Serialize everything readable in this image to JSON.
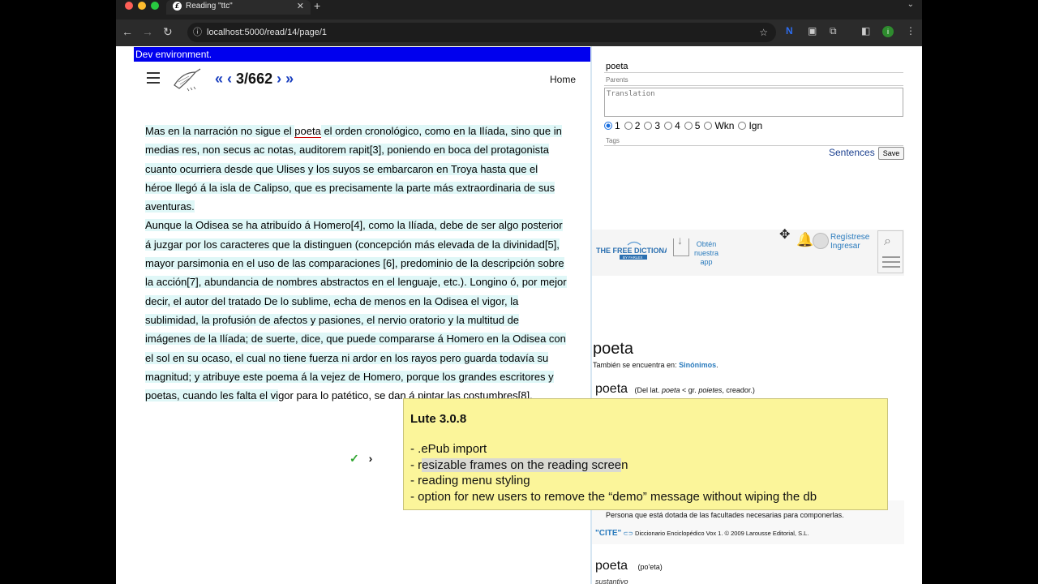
{
  "browser": {
    "tab_title": "Reading \"ttc\"",
    "tab_favicon_letter": "£",
    "url": "localhost:5000/read/14/page/1",
    "profile_initial": "i"
  },
  "reader": {
    "dev_banner": "Dev environment.",
    "pager": {
      "first": "«",
      "prev": "‹",
      "current": "3/662",
      "next": "›",
      "last": "»"
    },
    "home_label": "Home",
    "paragraphs": [
      [
        {
          "t": "Mas en la narración no sigue el ",
          "hl": true
        },
        {
          "t": "poeta",
          "sel": true
        },
        {
          "t": " el orden cronológico, como en la Ilíada, sino que in medias res, non secus ac notas, auditorem rapit[3], poniendo en boca del protagonista cuanto ocurriera desde que Ulises y los suyos se embarcaron en Troya hasta que el héroe llegó á la isla de Calipso, que es precisamente la parte más extraordinaria de sus aventuras.",
          "hl": true
        }
      ],
      [
        {
          "t": "Aunque la Odisea se ha atribuído á Homero[4], como la Ilíada, debe de ser algo  posterior á juzgar por los caracteres que la distinguen (concepción más elevada de la divinidad[5], mayor parsimonia en el uso de las comparaciones [6], predominio de la descripción sobre la acción[7], abundancia de nombres abstractos en el lenguaje, etc.). Longino ó, por mejor decir, el autor del tratado  De lo sublime, echa de menos en la Odisea el vigor, la sublimidad, la profusión de afectos y pasiones, el nervio oratorio y la multitud de imágenes de la Ilíada; de suerte, dice, que puede compararse á Homero en la Odisea con el sol en su ocaso, el cual no tiene fuerza ni ardor en los rayos pero guarda todavía su magnitud; y atribuye este poema á la vejez de Homero, porque los grandes escritores y poetas, cuando les falta el vi",
          "hl": true
        },
        {
          "t": "gor para lo patético, se dan á pintar las costumbres[8].",
          "hl": false
        }
      ]
    ],
    "check_mark": "✓",
    "next_page": "›"
  },
  "term_form": {
    "term": "poeta",
    "parents_placeholder": "Parents",
    "translation_placeholder": "Translation",
    "statuses": [
      "1",
      "2",
      "3",
      "4",
      "5",
      "Wkn",
      "Ign"
    ],
    "selected_status": "1",
    "tags_placeholder": "Tags",
    "sentences_label": "Sentences",
    "save_label": "Save"
  },
  "dictionary": {
    "logo_line1": "THE FREE DICTIONARY",
    "logo_line2": "BY FARLEX",
    "get_app": [
      "Obtén",
      "nuestra",
      "app"
    ],
    "register": "Regístrese",
    "login": "Ingresar",
    "headword": "poeta",
    "also_found_prefix": "También se encuentra en: ",
    "also_found_link": "Sinónimos",
    "entry1_word": "poeta",
    "entry1_etym_prefix": "(Del lat. ",
    "entry1_etym_lat": "poeta",
    "entry1_etym_mid": " < gr. ",
    "entry1_etym_gr": "poietes",
    "entry1_etym_suffix": ", creador.)",
    "definition_fragment": "Persona que está dotada de las facultades necesarias para componerlas.",
    "cite_label": "\"CITE\"",
    "cite_text": "Diccionario Enciclopédico Vox 1. © 2009 Larousse Editorial, S.L.",
    "entry2_word": "poeta",
    "entry2_pron": "(po'eta)",
    "entry2_pos": "sustantivo"
  },
  "release_popup": {
    "title": "Lute 3.0.8",
    "items": [
      "- .ePub import",
      "- resizable frames on the reading screen",
      "- reading menu styling",
      "- option for new users to remove the “demo” message without wiping the db"
    ]
  }
}
